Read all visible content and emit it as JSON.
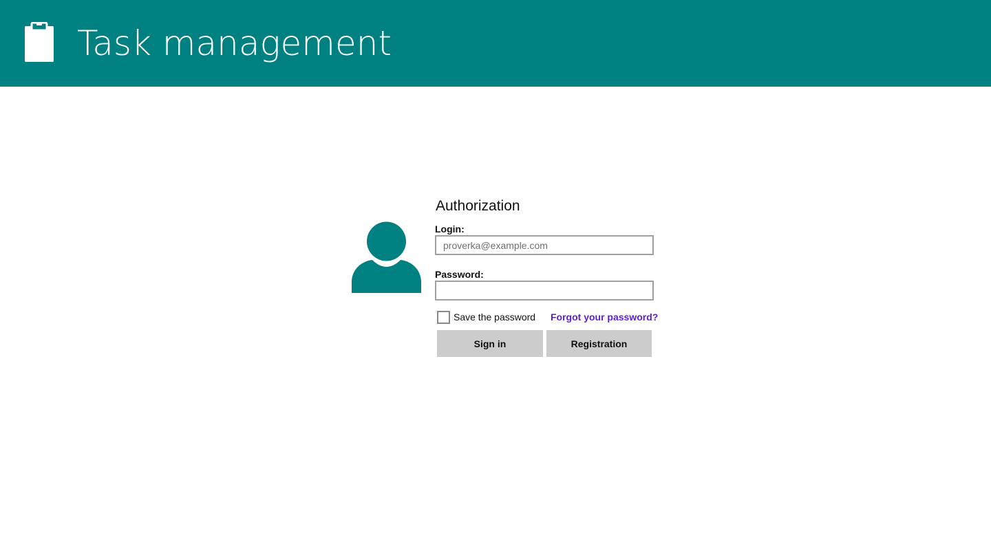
{
  "header": {
    "app_title": "Task management",
    "icon": "clipboard-icon",
    "background_color": "#008080"
  },
  "auth_form": {
    "title": "Authorization",
    "avatar_icon": "user-avatar-icon",
    "accent_color": "#008080",
    "login": {
      "label": "Login:",
      "placeholder": "proverka@example.com",
      "value": ""
    },
    "password": {
      "label": "Password:",
      "placeholder": "",
      "value": ""
    },
    "save_password": {
      "label": "Save the password",
      "checked": false
    },
    "forgot_password_link": "Forgot your password?",
    "link_color": "#5b1fd1",
    "sign_in_button": "Sign in",
    "registration_button": "Registration"
  }
}
